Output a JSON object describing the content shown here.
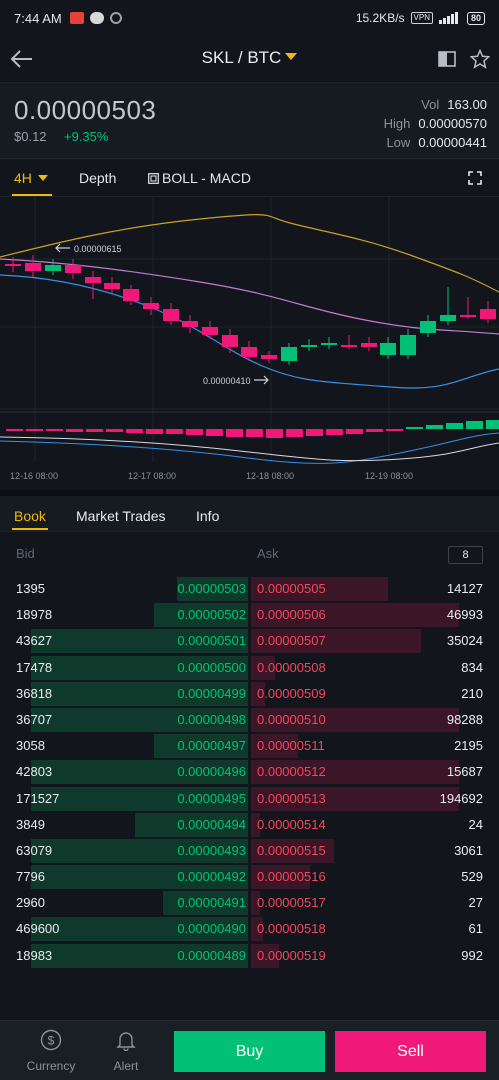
{
  "status": {
    "time": "7:44 AM",
    "net_speed": "15.2KB/s",
    "vpn": "VPN",
    "battery": "80"
  },
  "header": {
    "pair": "SKL / BTC"
  },
  "ticker": {
    "last_price": "0.00000503",
    "fiat": "$0.12",
    "change": "+9.35%",
    "vol_label": "Vol",
    "vol": "163.00",
    "high_label": "High",
    "high": "0.00000570",
    "low_label": "Low",
    "low": "0.00000441"
  },
  "chart_tabs": {
    "interval": "4H",
    "depth": "Depth",
    "indicators": "BOLL - MACD"
  },
  "chart_data": {
    "type": "candlestick",
    "high_marker": "0.00000615",
    "low_marker": "0.00000410",
    "x_ticks": [
      "12-16 08:00",
      "12-17 08:00",
      "12-18 08:00",
      "12-19 08:00"
    ],
    "colors": {
      "up": "#02c076",
      "down": "#f0197a",
      "upper_band": "#c9a227",
      "mid_band": "#c47bd0",
      "lower_band": "#3a8ee6"
    }
  },
  "book_tabs": [
    "Book",
    "Market Trades",
    "Info"
  ],
  "book": {
    "bid_label": "Bid",
    "ask_label": "Ask",
    "depth": "8",
    "rows": [
      {
        "bid_qty": "1395",
        "bid_px": "0.00000503",
        "ask_px": "0.00000505",
        "ask_qty": "14127",
        "bid_w": 0.3,
        "ask_w": 0.58
      },
      {
        "bid_qty": "18978",
        "bid_px": "0.00000502",
        "ask_px": "0.00000506",
        "ask_qty": "46993",
        "bid_w": 0.4,
        "ask_w": 0.88
      },
      {
        "bid_qty": "43627",
        "bid_px": "0.00000501",
        "ask_px": "0.00000507",
        "ask_qty": "35024",
        "bid_w": 0.92,
        "ask_w": 0.72
      },
      {
        "bid_qty": "17478",
        "bid_px": "0.00000500",
        "ask_px": "0.00000508",
        "ask_qty": "834",
        "bid_w": 0.92,
        "ask_w": 0.1
      },
      {
        "bid_qty": "36818",
        "bid_px": "0.00000499",
        "ask_px": "0.00000509",
        "ask_qty": "210",
        "bid_w": 0.92,
        "ask_w": 0.06
      },
      {
        "bid_qty": "36707",
        "bid_px": "0.00000498",
        "ask_px": "0.00000510",
        "ask_qty": "98288",
        "bid_w": 0.92,
        "ask_w": 0.88
      },
      {
        "bid_qty": "3058",
        "bid_px": "0.00000497",
        "ask_px": "0.00000511",
        "ask_qty": "2195",
        "bid_w": 0.4,
        "ask_w": 0.2
      },
      {
        "bid_qty": "42803",
        "bid_px": "0.00000496",
        "ask_px": "0.00000512",
        "ask_qty": "15687",
        "bid_w": 0.92,
        "ask_w": 0.88
      },
      {
        "bid_qty": "171527",
        "bid_px": "0.00000495",
        "ask_px": "0.00000513",
        "ask_qty": "194692",
        "bid_w": 0.92,
        "ask_w": 0.88
      },
      {
        "bid_qty": "3849",
        "bid_px": "0.00000494",
        "ask_px": "0.00000514",
        "ask_qty": "24",
        "bid_w": 0.48,
        "ask_w": 0.04
      },
      {
        "bid_qty": "63079",
        "bid_px": "0.00000493",
        "ask_px": "0.00000515",
        "ask_qty": "3061",
        "bid_w": 0.92,
        "ask_w": 0.35
      },
      {
        "bid_qty": "7796",
        "bid_px": "0.00000492",
        "ask_px": "0.00000516",
        "ask_qty": "529",
        "bid_w": 0.92,
        "ask_w": 0.25
      },
      {
        "bid_qty": "2960",
        "bid_px": "0.00000491",
        "ask_px": "0.00000517",
        "ask_qty": "27",
        "bid_w": 0.36,
        "ask_w": 0.04
      },
      {
        "bid_qty": "469600",
        "bid_px": "0.00000490",
        "ask_px": "0.00000518",
        "ask_qty": "61",
        "bid_w": 0.92,
        "ask_w": 0.05
      },
      {
        "bid_qty": "18983",
        "bid_px": "0.00000489",
        "ask_px": "0.00000519",
        "ask_qty": "992",
        "bid_w": 0.92,
        "ask_w": 0.12
      }
    ]
  },
  "bottom": {
    "currency": "Currency",
    "alert": "Alert",
    "buy": "Buy",
    "sell": "Sell"
  }
}
